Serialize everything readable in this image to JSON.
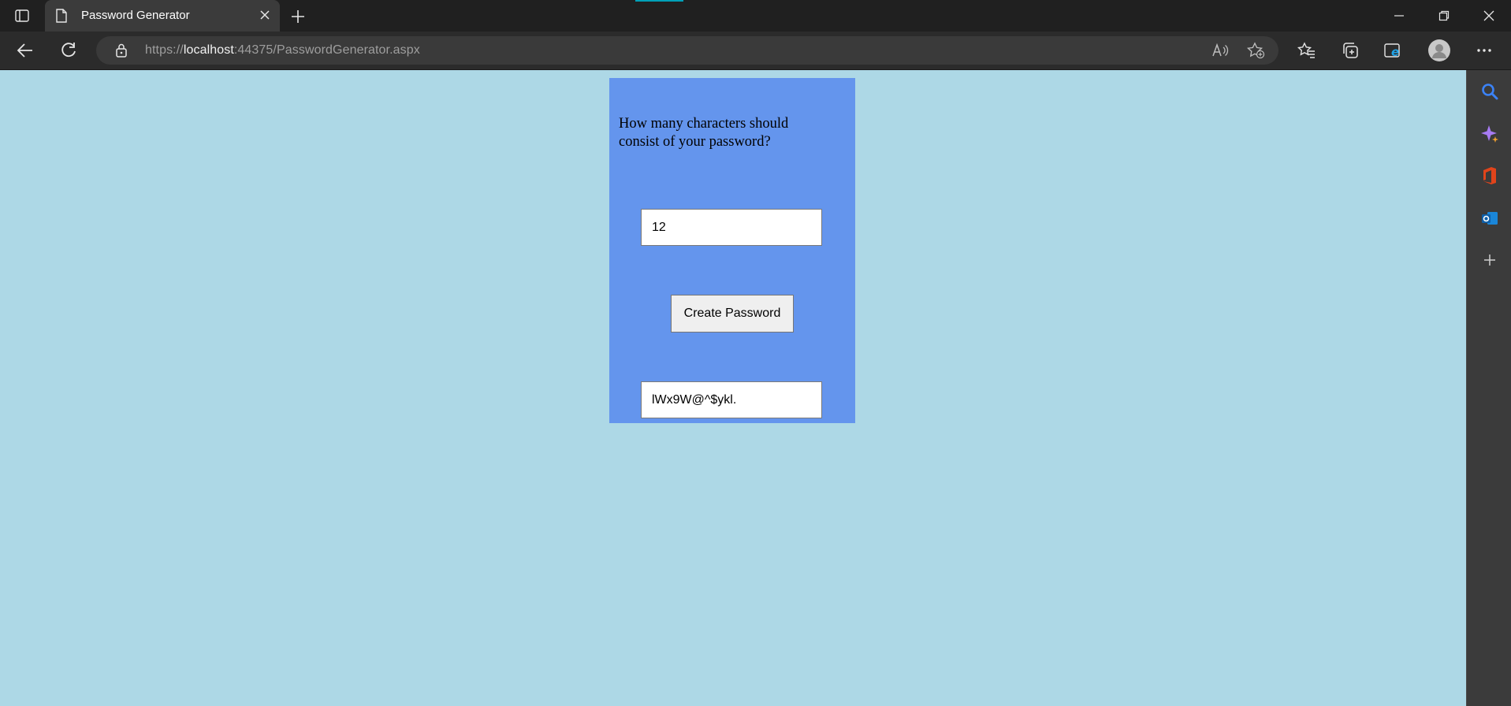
{
  "browser": {
    "tab_title": "Password Generator",
    "url_prefix": "https://",
    "url_host": "localhost",
    "url_rest": ":44375/PasswordGenerator.aspx"
  },
  "page": {
    "question": "How many characters should consist of your password?",
    "length_value": "12",
    "button_label": "Create Password",
    "generated_password": "lWx9W@^$ykl."
  },
  "colors": {
    "page_background": "#add8e6",
    "panel_background": "#6495ed"
  }
}
